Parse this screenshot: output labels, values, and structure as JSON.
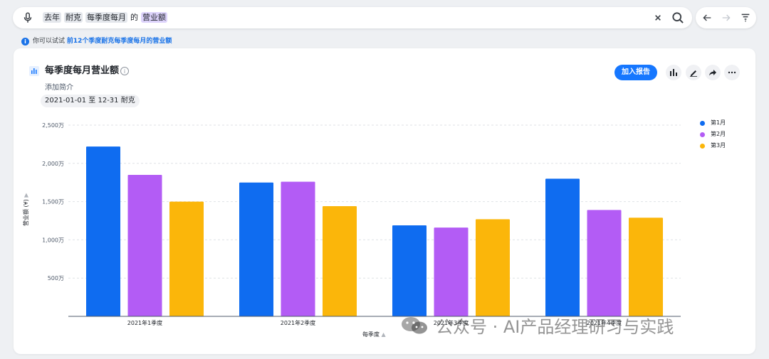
{
  "search": {
    "tokens": [
      "去年",
      "耐克",
      "每季度每月",
      "的",
      "营业额"
    ]
  },
  "hint": {
    "prefix": "你可以试试",
    "suggestion": "前12个季度耐克每季度每月的营业额"
  },
  "card": {
    "title": "每季度每月营业额",
    "description": "添加简介",
    "filter_chip": "2021-01-01 至 12-31 耐克",
    "add_button": "加入报告"
  },
  "watermark": "公众号 · AI产品经理研习与实践",
  "colors": {
    "series1": "#0f6cf0",
    "series2": "#b35cf5",
    "series3": "#fbb60a",
    "accent": "#1677ff"
  },
  "chart_data": {
    "type": "bar",
    "categories": [
      "2021年1季度",
      "2021年2季度",
      "2021年3季度",
      "2021年4季度"
    ],
    "series": [
      {
        "name": "第1月",
        "values": [
          2220,
          1750,
          1190,
          1800
        ]
      },
      {
        "name": "第2月",
        "values": [
          1850,
          1760,
          1160,
          1390
        ]
      },
      {
        "name": "第3月",
        "values": [
          1500,
          1440,
          1270,
          1290
        ]
      }
    ],
    "yticks": [
      500,
      1000,
      1500,
      2000,
      2500
    ],
    "ytick_labels": [
      "500万",
      "1,000万",
      "1,500万",
      "2,000万",
      "2,500万"
    ],
    "ylim": [
      0,
      2500
    ],
    "xlabel": "每季度",
    "ylabel": "营业额 (¥)",
    "grid": true,
    "legend": "right"
  }
}
